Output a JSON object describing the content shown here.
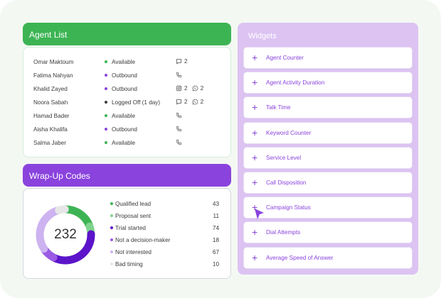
{
  "agent_list": {
    "title": "Agent List",
    "agents": [
      {
        "name": "Omar Maktoum",
        "status": "Available",
        "status_color": "#3db454",
        "contacts": [
          {
            "icon": "chat-icon",
            "count": "2"
          }
        ]
      },
      {
        "name": "Fatima Nahyan",
        "status": "Outbound",
        "status_color": "#8a43dd",
        "contacts": [
          {
            "icon": "phone-icon",
            "count": ""
          }
        ]
      },
      {
        "name": "Khalid Zayed",
        "status": "Outbound",
        "status_color": "#8a43dd",
        "contacts": [
          {
            "icon": "instagram-icon",
            "count": "2"
          },
          {
            "icon": "whatsapp-icon",
            "count": "2"
          }
        ]
      },
      {
        "name": "Noora Sabah",
        "status": "Logged Off (1 day)",
        "status_color": "#3b3b3b",
        "contacts": [
          {
            "icon": "chat-icon",
            "count": "2"
          },
          {
            "icon": "whatsapp-icon",
            "count": "2"
          }
        ]
      },
      {
        "name": "Hamad Bader",
        "status": "Available",
        "status_color": "#3db454",
        "contacts": [
          {
            "icon": "phone-icon",
            "count": ""
          }
        ]
      },
      {
        "name": "Aisha Khalifa",
        "status": "Outbound",
        "status_color": "#8a43dd",
        "contacts": [
          {
            "icon": "phone-icon",
            "count": ""
          }
        ]
      },
      {
        "name": "Salma Jaber",
        "status": "Available",
        "status_color": "#3db454",
        "contacts": [
          {
            "icon": "phone-icon",
            "count": ""
          }
        ]
      }
    ]
  },
  "wrap_up": {
    "title": "Wrap-Up Codes",
    "total": "232",
    "codes": [
      {
        "label": "Qualified lead",
        "value": 43,
        "color": "#3db454"
      },
      {
        "label": "Proposal sent",
        "value": 11,
        "color": "#7ed38d"
      },
      {
        "label": "Trial started",
        "value": 74,
        "color": "#5b14c9"
      },
      {
        "label": "Not a decision-maker",
        "value": 18,
        "color": "#9a5ae3"
      },
      {
        "label": "Not interested",
        "value": 67,
        "color": "#cdb3f0"
      },
      {
        "label": "Bad timing",
        "value": 10,
        "color": "#e6e6e6"
      }
    ]
  },
  "widgets": {
    "title": "Widgets",
    "items": [
      "Agent Counter",
      "Agent Activity Duration",
      "Talk Time",
      "Keyword Counter",
      "Service Level",
      "Call Disposition",
      "Campaign Status",
      "Dial Attempts",
      "Average Speed of Answer"
    ]
  }
}
